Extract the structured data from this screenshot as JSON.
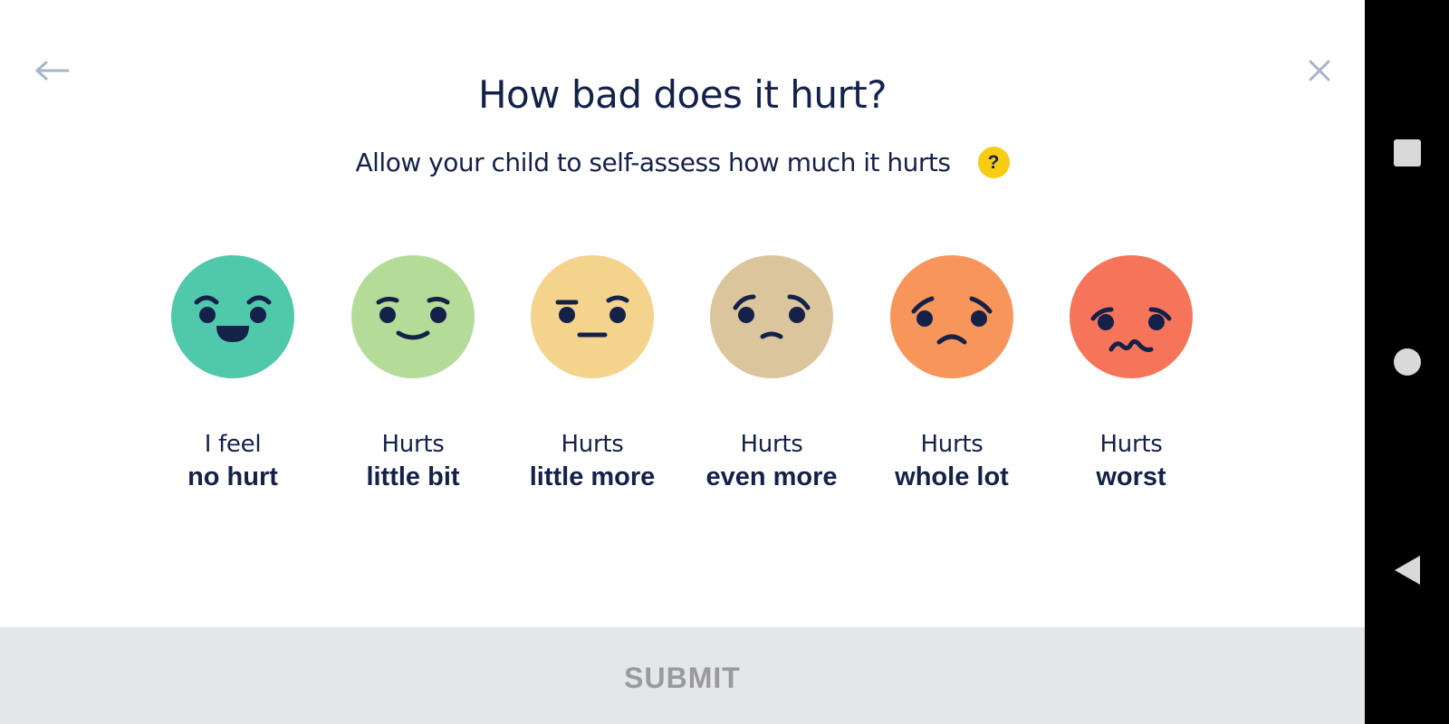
{
  "header": {
    "title": "How bad does it hurt?",
    "subtitle": "Allow your child to self-assess how much it hurts",
    "help_label": "?"
  },
  "faces": [
    {
      "top": "I feel",
      "bottom": "no hurt",
      "color": "#4fc8ab",
      "icon": "face-no-hurt-icon"
    },
    {
      "top": "Hurts",
      "bottom": "little bit",
      "color": "#b5db98",
      "icon": "face-little-bit-icon"
    },
    {
      "top": "Hurts",
      "bottom": "little more",
      "color": "#f4d38d",
      "icon": "face-little-more-icon"
    },
    {
      "top": "Hurts",
      "bottom": "even more",
      "color": "#dbc59c",
      "icon": "face-even-more-icon"
    },
    {
      "top": "Hurts",
      "bottom": "whole lot",
      "color": "#f8955a",
      "icon": "face-whole-lot-icon"
    },
    {
      "top": "Hurts",
      "bottom": "worst",
      "color": "#f6755a",
      "icon": "face-worst-icon"
    }
  ],
  "submit": {
    "label": "SUBMIT"
  },
  "colors": {
    "text": "#142149",
    "icon_muted": "#a6b4cc",
    "help_badge": "#f9cc14",
    "submit_bg": "#e4e6ea",
    "submit_text": "#9a9a9a"
  }
}
